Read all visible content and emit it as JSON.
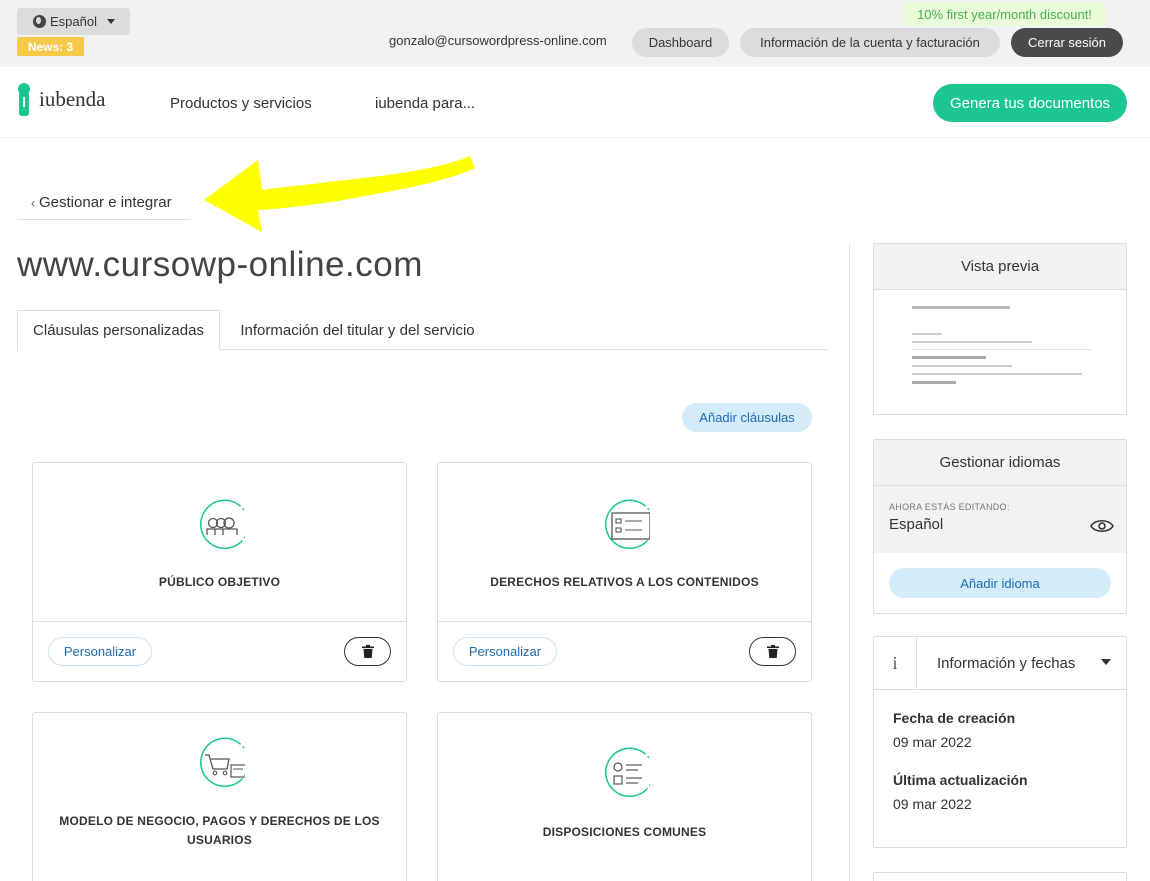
{
  "topbar": {
    "language_label": "Español",
    "news_label": "News: 3",
    "discount_label": "10% first year/month discount!",
    "user_email": "gonzalo@cursowordpress-online.com",
    "dashboard_label": "Dashboard",
    "account_label": "Información de la cuenta y facturación",
    "logout_label": "Cerrar sesión"
  },
  "nav": {
    "logo_text": "iubenda",
    "products_label": "Productos y servicios",
    "iubenda_for_label": "iubenda para...",
    "cta_label": "Genera tus documentos"
  },
  "main": {
    "back_label": "Gestionar e integrar",
    "site_title": "www.cursowp-online.com",
    "tabs": [
      {
        "label": "Cláusulas personalizadas"
      },
      {
        "label": "Información del titular y del servicio"
      }
    ],
    "add_clauses_label": "Añadir cláusulas",
    "customize_label": "Personalizar",
    "cards": [
      {
        "title": "PÚBLICO OBJETIVO",
        "icon": "audience-icon"
      },
      {
        "title": "DERECHOS RELATIVOS A LOS CONTENIDOS",
        "icon": "content-rights-icon"
      },
      {
        "title": "MODELO DE NEGOCIO, PAGOS Y DERECHOS DE LOS USUARIOS",
        "icon": "cart-payment-icon"
      },
      {
        "title": "DISPOSICIONES COMUNES",
        "icon": "checklist-icon"
      }
    ]
  },
  "sidebar": {
    "preview_title": "Vista previa",
    "languages_title": "Gestionar idiomas",
    "editing_label": "AHORA ESTÁS EDITANDO:",
    "editing_lang": "Español",
    "add_language_label": "Añadir idioma",
    "info_title": "Información y fechas",
    "created_label": "Fecha de creación",
    "created_value": "09 mar 2022",
    "updated_label": "Última actualización",
    "updated_value": "09 mar 2022"
  },
  "colors": {
    "brand_green": "#1cc691",
    "link_blue": "#1b6bb0",
    "highlight_yellow": "#ffff00"
  }
}
